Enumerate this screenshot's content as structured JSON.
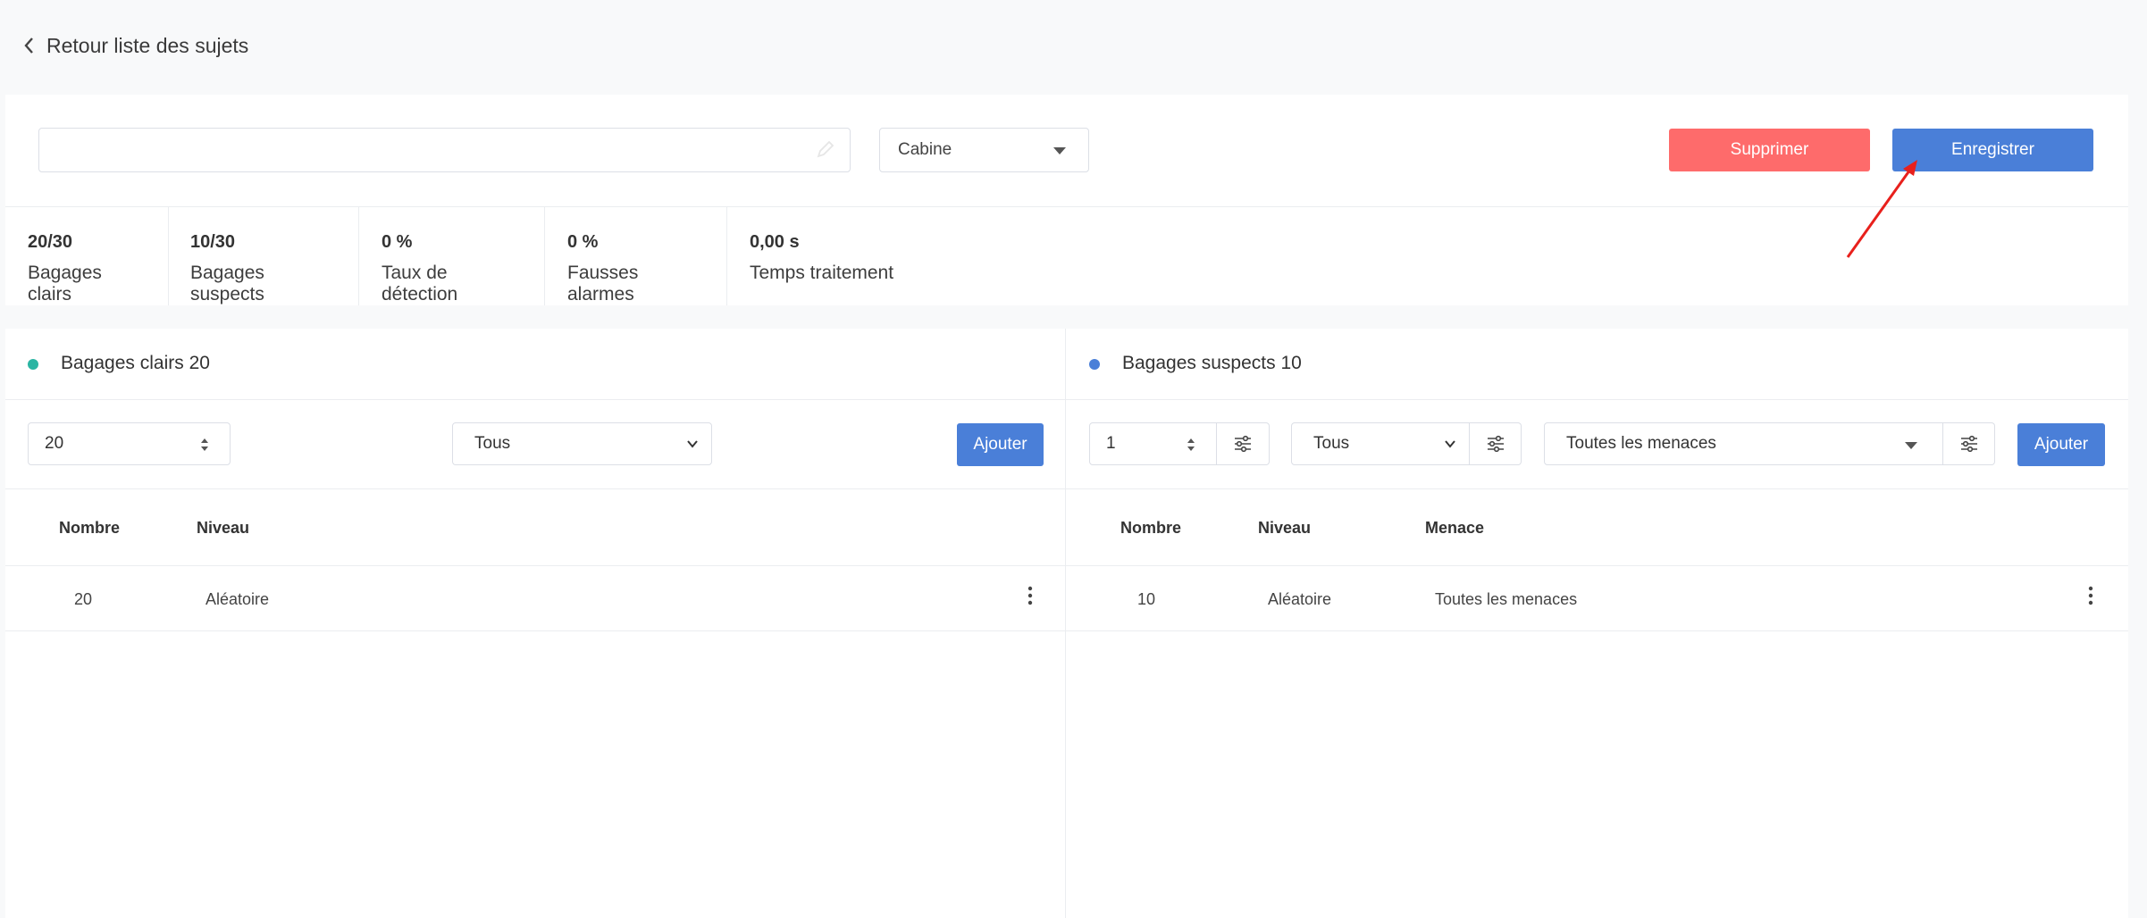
{
  "back_link": {
    "label": "Retour liste des sujets"
  },
  "subject": {
    "title_value": "",
    "category": "Cabine"
  },
  "actions": {
    "delete_label": "Supprimer",
    "save_label": "Enregistrer"
  },
  "stats": [
    {
      "value": "20/30",
      "label": "Bagages clairs"
    },
    {
      "value": "10/30",
      "label": "Bagages suspects"
    },
    {
      "value": "0 %",
      "label": "Taux de détection"
    },
    {
      "value": "0 %",
      "label": "Fausses alarmes"
    },
    {
      "value": "0,00 s",
      "label": "Temps traitement"
    }
  ],
  "left_panel": {
    "title": "Bagages clairs 20",
    "dot_color": "#2bb5a3",
    "count_value": "20",
    "level_select": "Tous",
    "add_label": "Ajouter",
    "columns": [
      "Nombre",
      "Niveau"
    ],
    "rows": [
      {
        "nombre": "20",
        "niveau": "Aléatoire"
      }
    ]
  },
  "right_panel": {
    "title": "Bagages suspects 10",
    "dot_color": "#4a7fd8",
    "count_value": "1",
    "level_select": "Tous",
    "threat_select": "Toutes les menaces",
    "add_label": "Ajouter",
    "columns": [
      "Nombre",
      "Niveau",
      "Menace"
    ],
    "rows": [
      {
        "nombre": "10",
        "niveau": "Aléatoire",
        "menace": "Toutes les menaces"
      }
    ]
  },
  "colors": {
    "accent": "#4a7fd8",
    "danger": "#fe6b6b",
    "annotation_arrow": "#e8201c"
  }
}
